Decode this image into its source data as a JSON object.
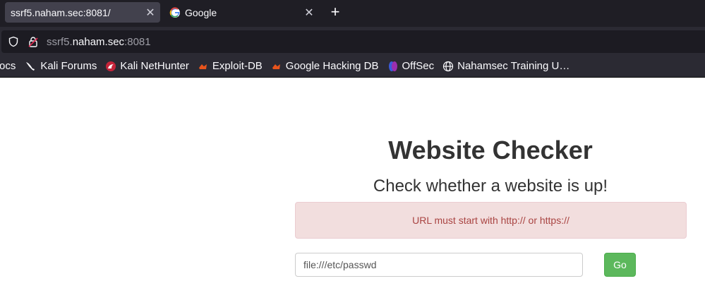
{
  "tabs": [
    {
      "title": "ssrf5.naham.sec:8081/",
      "active": true
    },
    {
      "title": "Google",
      "active": false
    }
  ],
  "url": {
    "prefix": "ssrf5.",
    "host": "naham.sec",
    "suffix": ":8081"
  },
  "bookmarks": [
    {
      "label": "ocs",
      "icon": "none"
    },
    {
      "label": "Kali Forums",
      "icon": "kali-dragon-icon"
    },
    {
      "label": "Kali NetHunter",
      "icon": "nethunter-icon"
    },
    {
      "label": "Exploit-DB",
      "icon": "exploit-db-icon"
    },
    {
      "label": "Google Hacking DB",
      "icon": "exploit-db-icon"
    },
    {
      "label": "OffSec",
      "icon": "offsec-icon"
    },
    {
      "label": "Nahamsec Training U…",
      "icon": "globe-icon"
    }
  ],
  "page": {
    "title": "Website Checker",
    "subtitle": "Check whether a website is up!",
    "alert": "URL must start with http:// or https://",
    "input_value": "file:///etc/passwd",
    "go_label": "Go"
  },
  "colors": {
    "alert_bg": "#f2dede",
    "alert_text": "#a94442",
    "go_button": "#5cb85c"
  }
}
